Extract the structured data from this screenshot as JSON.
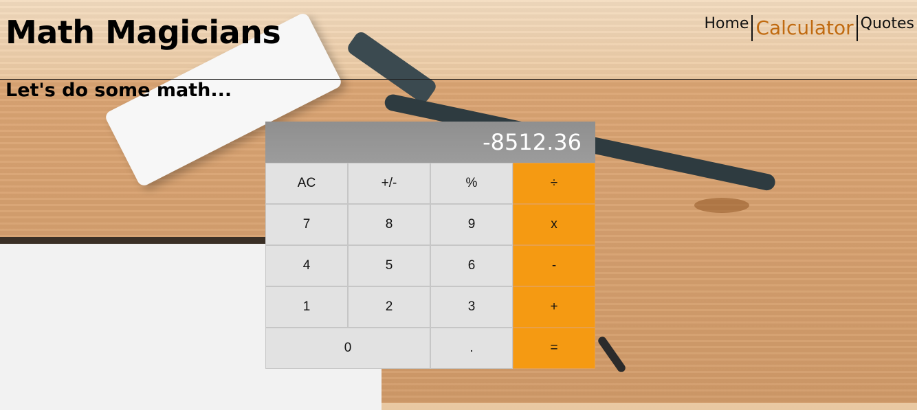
{
  "header": {
    "logo": "Math Magicians",
    "nav": [
      {
        "label": "Home",
        "active": false
      },
      {
        "label": "Calculator",
        "active": true
      },
      {
        "label": "Quotes",
        "active": false
      }
    ]
  },
  "subtitle": "Let's do some math...",
  "calculator": {
    "display": "-8512.36",
    "keys": {
      "ac": "AC",
      "sign": "+/-",
      "percent": "%",
      "divide": "÷",
      "seven": "7",
      "eight": "8",
      "nine": "9",
      "multiply": "x",
      "four": "4",
      "five": "5",
      "six": "6",
      "subtract": "-",
      "one": "1",
      "two": "2",
      "three": "3",
      "add": "+",
      "zero": "0",
      "decimal": ".",
      "equals": "="
    }
  },
  "colors": {
    "accent": "#f59a12",
    "active_nav": "#c06a10",
    "display_bg": "#999999",
    "key_bg": "#e2e2e2"
  }
}
